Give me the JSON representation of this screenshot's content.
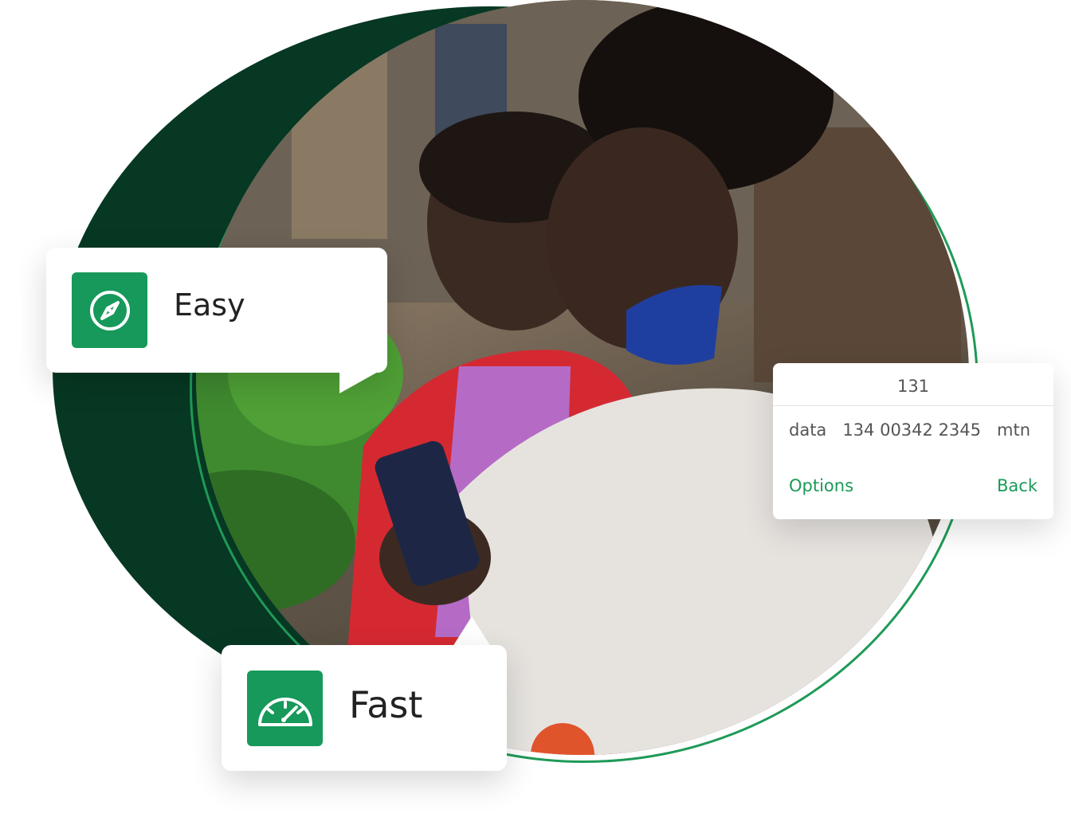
{
  "features": {
    "easy": {
      "label": "Easy",
      "icon": "compass-icon"
    },
    "fast": {
      "label": "Fast",
      "icon": "speedometer-icon"
    }
  },
  "ussd": {
    "code": "131",
    "message": "data   134 00342 2345   mtn",
    "options_label": "Options",
    "back_label": "Back"
  },
  "colors": {
    "brand_green": "#16995a",
    "dark_green": "#063823",
    "ring_green": "#1f9a57"
  },
  "photo": {
    "subject": "two women looking at a smartphone in a market"
  }
}
